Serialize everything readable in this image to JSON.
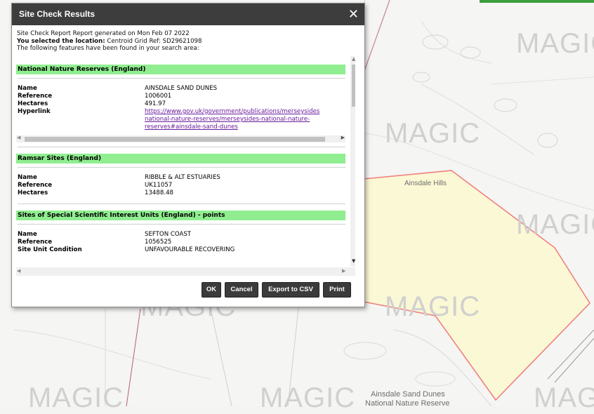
{
  "map": {
    "watermark": "MAGIC",
    "labels": {
      "ainsdale_hills": "Ainsdale Hills",
      "dunes_line1": "Ainsdale Sand Dunes",
      "dunes_line2": "National Nature Reserve"
    },
    "colors": {
      "polygon_fill": "#fbf8cf",
      "polygon_stroke": "#f08080",
      "green_tab": "#3d9e3d"
    }
  },
  "dialog": {
    "title": "Site Check Results",
    "intro": {
      "line1": "Site Check Report Report generated on Mon Feb 07 2022",
      "location_label": "You selected the location:",
      "location_value": "Centroid Grid Ref: SD29621098",
      "line3": "The following features have been found in your search area:"
    },
    "sections": [
      {
        "title": "National Nature Reserves (England)",
        "rows": [
          {
            "key": "Name",
            "value": "AINSDALE SAND DUNES"
          },
          {
            "key": "Reference",
            "value": "1006001"
          },
          {
            "key": "Hectares",
            "value": "491.97"
          }
        ],
        "hyperlink": {
          "key": "Hyperlink",
          "line1": "https://www.gov.uk/government/publications/merseysides",
          "line2": "national-nature-reserves/merseysides-national-nature-",
          "line3": "reserves#ainsdale-sand-dunes"
        }
      },
      {
        "title": "Ramsar Sites (England)",
        "rows": [
          {
            "key": "Name",
            "value": "RIBBLE & ALT ESTUARIES"
          },
          {
            "key": "Reference",
            "value": "UK11057"
          },
          {
            "key": "Hectares",
            "value": "13488.48"
          }
        ]
      },
      {
        "title": "Sites of Special Scientific Interest Units (England) - points",
        "rows": [
          {
            "key": "Name",
            "value": "SEFTON COAST"
          },
          {
            "key": "Reference",
            "value": "1056525"
          },
          {
            "key": "Site Unit Condition",
            "value": "UNFAVOURABLE RECOVERING"
          }
        ]
      }
    ],
    "buttons": {
      "ok": "OK",
      "cancel": "Cancel",
      "export": "Export to CSV",
      "print": "Print"
    },
    "colors": {
      "title_bar": "#3d3d3d",
      "section_header": "#90ee90",
      "button": "#3b3b3b"
    }
  }
}
